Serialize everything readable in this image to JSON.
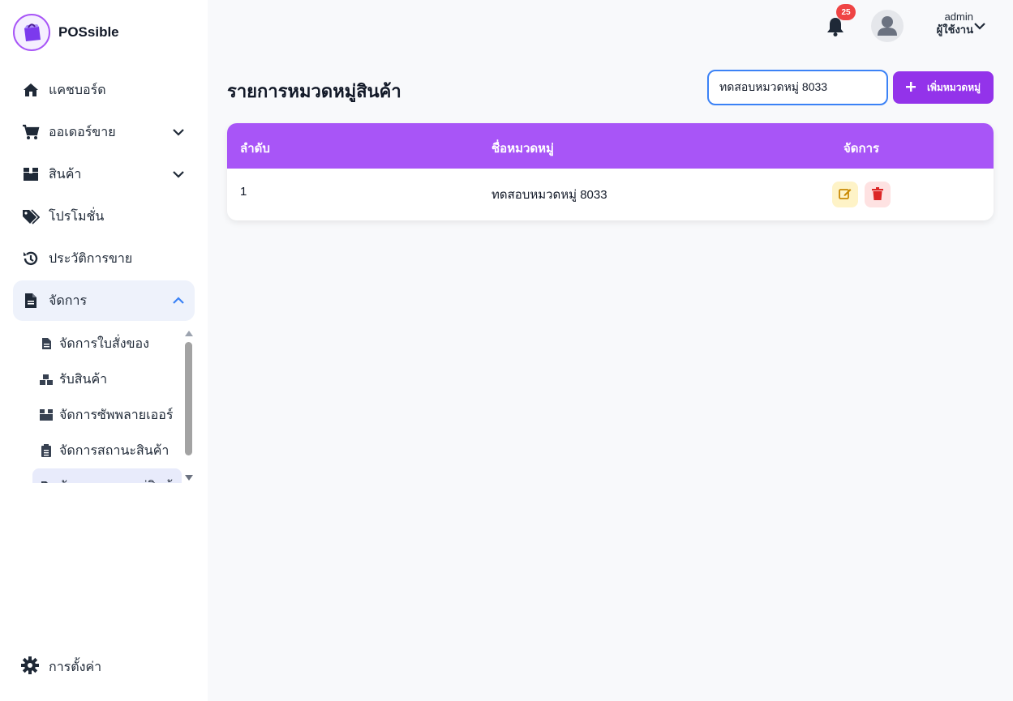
{
  "brand": {
    "name": "POSsible"
  },
  "sidebar": {
    "items": [
      {
        "label": "แคชบอร์ด",
        "icon": "home-icon",
        "has_chevron": false
      },
      {
        "label": "ออเดอร์ขาย",
        "icon": "cart-icon",
        "has_chevron": true
      },
      {
        "label": "สินค้า",
        "icon": "box-icon",
        "has_chevron": true
      },
      {
        "label": "โปรโมชั่น",
        "icon": "tags-icon",
        "has_chevron": false
      },
      {
        "label": "ประวัติการขาย",
        "icon": "history-icon",
        "has_chevron": false
      },
      {
        "label": "จัดการ",
        "icon": "document-icon",
        "has_chevron": true,
        "expanded": true
      }
    ],
    "sub_items": [
      {
        "label": "จัดการใบสั่งของ",
        "icon": "file-icon"
      },
      {
        "label": "รับสินค้า",
        "icon": "boxes-icon"
      },
      {
        "label": "จัดการซัพพลายเออร์",
        "icon": "box-icon"
      },
      {
        "label": "จัดการสถานะสินค้า",
        "icon": "clipboard-icon"
      },
      {
        "label": "จัดการหมวดหมู่สินค้า",
        "icon": "tag-icon",
        "active": true
      }
    ],
    "settings_label": "การตั้งค่า"
  },
  "topbar": {
    "notification_count": "25",
    "user_name": "admin",
    "user_role": "ผู้ใช้งาน"
  },
  "main": {
    "title": "รายการหมวดหมู่สินค้า",
    "search_value": "ทดสอบหมวดหมู่ 8033",
    "add_button_label": "เพิ่มหมวดหมู่",
    "table": {
      "headers": [
        "ลำดับ",
        "ชื่อหมวดหมู่",
        "จัดการ"
      ],
      "rows": [
        {
          "index": "1",
          "name": "ทดสอบหมวดหมู่ 8033"
        }
      ]
    }
  },
  "colors": {
    "accent": "#a855f7",
    "button": "#9333ea",
    "badge": "#ef4444",
    "edit_bg": "#fef3c7",
    "delete_bg": "#fee2e2",
    "focus_border": "#3b82f6"
  }
}
